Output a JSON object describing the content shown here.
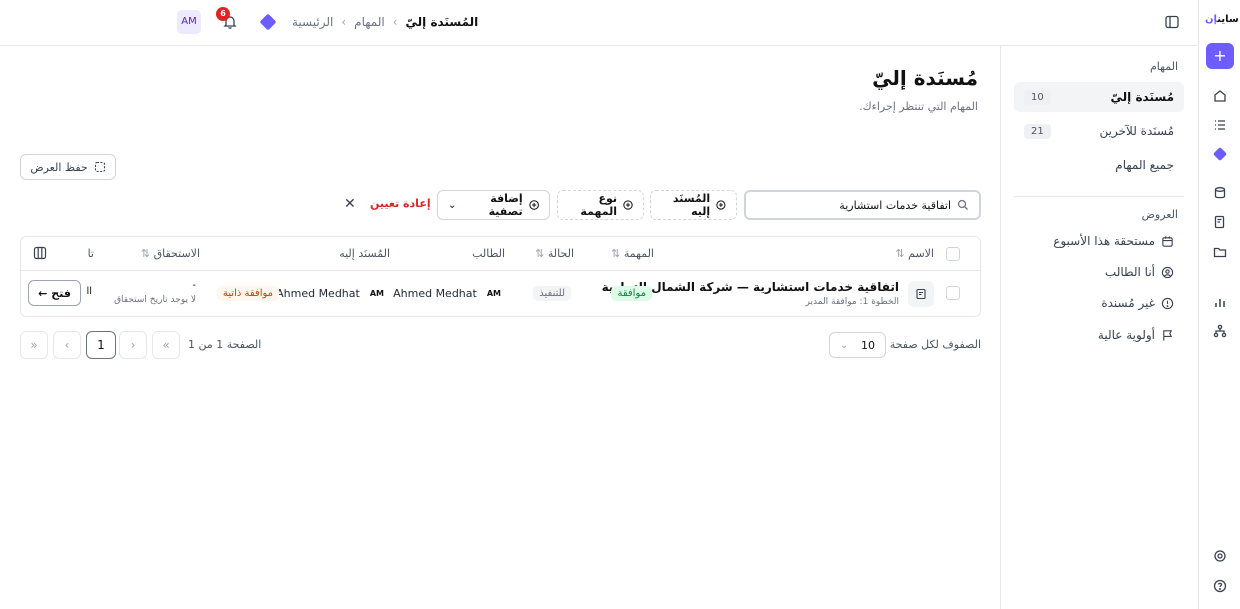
{
  "app": {
    "logo_text": "ساين",
    "logo_accent": "إن"
  },
  "header": {
    "breadcrumb": {
      "home": "الرئيسية",
      "tasks": "المهام",
      "current": "المُسنَدة إليّ"
    },
    "notification_count": "6",
    "avatar": "AM"
  },
  "sidebar": {
    "tasks_section": "المهام",
    "items": [
      {
        "label": "مُسنَدة إليّ",
        "count": "10"
      },
      {
        "label": "مُسنَدة للآخرين",
        "count": "21"
      },
      {
        "label": "جميع المهام",
        "count": ""
      }
    ],
    "views_section": "العروض",
    "views": [
      {
        "label": "مستحقة هذا الأسبوع",
        "icon": "calendar-icon"
      },
      {
        "label": "أنا الطالب",
        "icon": "user-circle-icon"
      },
      {
        "label": "غير مُسندة",
        "icon": "alert-circle-icon"
      },
      {
        "label": "أولوية عالية",
        "icon": "flag-icon"
      }
    ]
  },
  "main": {
    "title": "مُسنَدة إليّ",
    "subtitle": "المهام التي تنتظر إجراءك.",
    "save_view": "حفظ العرض",
    "search_value": "اتفاقية خدمات استشارية",
    "filters": {
      "assignee": "المُسنَد إليه",
      "task_type": "نوع المهمة",
      "add_filter": "إضافة تصفية"
    },
    "reset": "إعادة تعيين"
  },
  "table": {
    "columns": {
      "name": "الاسم",
      "task": "المهمة",
      "status": "الحالة",
      "requester": "الطالب",
      "assignee": "المُسنَد إليه",
      "due": "الاستحقاق",
      "date": "تا"
    },
    "rows": [
      {
        "name": "اتفاقية خدمات استشارية — شركة الشمال التجارية",
        "step": "الخطوة 1: موافقة المدير",
        "task": "موافقة",
        "status": "للتنفيذ",
        "requester": "Ahmed Medhat",
        "requester_initials": "AM",
        "assignee": "Ahmed Medhat",
        "assignee_initials": "AM",
        "assign_tag": "موافقة ذاتية",
        "due": "-",
        "due_note": "لا يوجد تاريخ استحقاق",
        "date_col": "اا",
        "action": "فتح"
      }
    ]
  },
  "pagination": {
    "rows_per_page_label": "الصفوف لكل صفحة",
    "rows_per_page": "10",
    "page_label": "الصفحة 1 من 1",
    "current_page": "1"
  }
}
